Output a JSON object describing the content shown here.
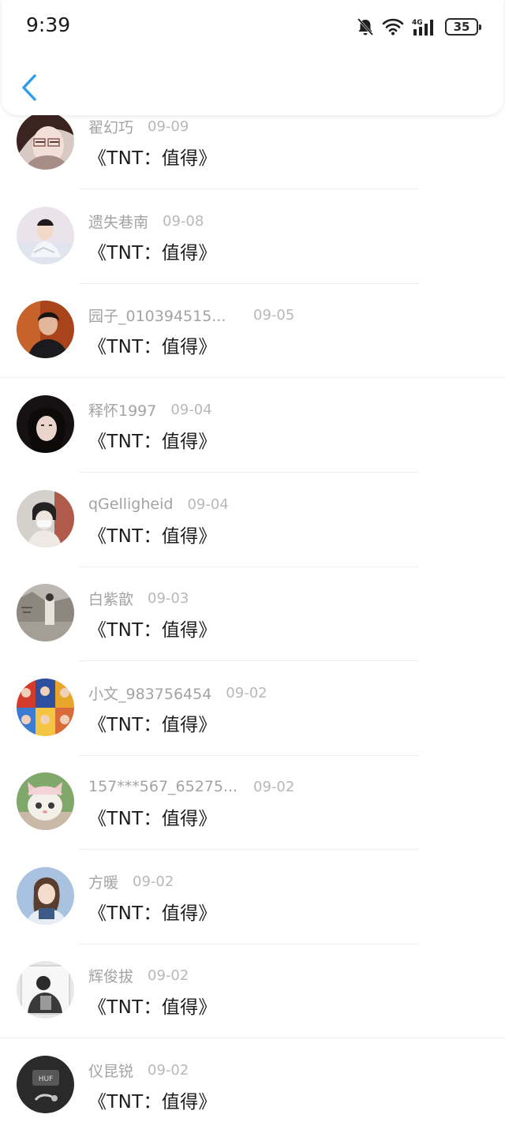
{
  "status_bar": {
    "time": "9:39",
    "battery_level": "35",
    "icons": [
      "bell-off-icon",
      "wifi-icon",
      "cellular-4g-icon",
      "battery-icon"
    ]
  },
  "header": {
    "back_icon": "chevron-left-icon",
    "accent_color": "#2f9cf0"
  },
  "posts": [
    {
      "user": "翟幻巧",
      "date": "09-09",
      "title": "《TNT：值得》"
    },
    {
      "user": "遗失巷南",
      "date": "09-08",
      "title": "《TNT：值得》"
    },
    {
      "user": "园子_010394515...",
      "date": "09-05",
      "title": "《TNT：值得》"
    },
    {
      "user": "释怀1997",
      "date": "09-04",
      "title": "《TNT：值得》"
    },
    {
      "user": "qGelligheid",
      "date": "09-04",
      "title": "《TNT：值得》"
    },
    {
      "user": "白紫歆",
      "date": "09-03",
      "title": "《TNT：值得》"
    },
    {
      "user": "小文_983756454",
      "date": "09-02",
      "title": "《TNT：值得》"
    },
    {
      "user": "157***567_65275...",
      "date": "09-02",
      "title": "《TNT：值得》"
    },
    {
      "user": "方暖",
      "date": "09-02",
      "title": "《TNT：值得》"
    },
    {
      "user": "辉俊拔",
      "date": "09-02",
      "title": "《TNT：值得》"
    },
    {
      "user": "仪昆锐",
      "date": "09-02",
      "title": "《TNT：值得》"
    }
  ]
}
